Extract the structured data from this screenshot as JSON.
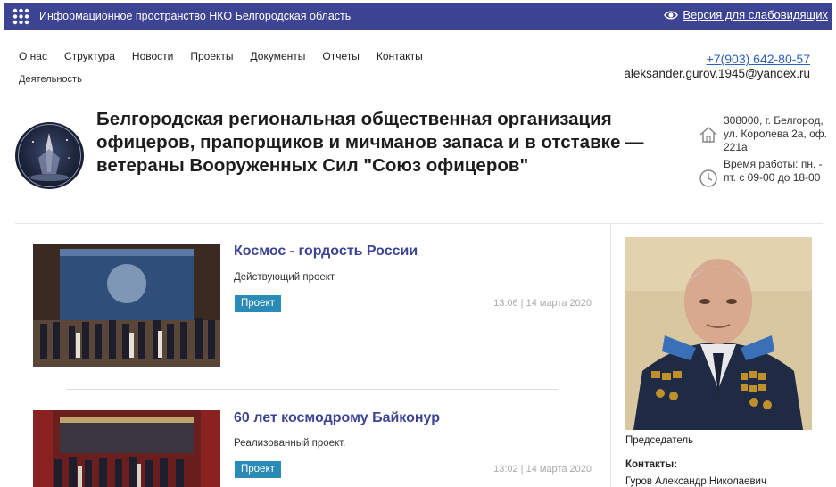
{
  "topbar": {
    "brand": "Информационное пространство НКО Белгородская область",
    "vision_label": "Версия для слабовидящих",
    "bg_color": "#3d4494"
  },
  "nav": {
    "items": [
      "О нас",
      "Структура",
      "Новости",
      "Проекты",
      "Документы",
      "Отчеты",
      "Контакты"
    ],
    "second_row": "Деятельность"
  },
  "contacts_top": {
    "phone": "+7(903) 642-80-57",
    "email": "aleksander.gurov.1945@yandex.ru"
  },
  "org": {
    "title": "Белгородская региональная общественная организация офицеров, прапорщиков и мичманов запаса и в отставке — ветераны Вооруженных Сил \"Союз офицеров\""
  },
  "address": {
    "text": "308000, г. Белгород, ул. Королева 2а, оф. 221а",
    "hours": "Время работы: пн. - пт. с 09-00 до 18-00"
  },
  "news": [
    {
      "title": "Космос - гордость России",
      "desc": "Действующий проект.",
      "tag": "Проект",
      "date": "13:06 | 14 марта 2020"
    },
    {
      "title": "60 лет космодрому Байконур",
      "desc": "Реализованный проект.",
      "tag": "Проект",
      "date": "13:02 | 14 марта 2020"
    }
  ],
  "sidebar": {
    "caption": "Председатель",
    "contacts_heading": "Контакты:",
    "contacts_name": "Гуров Александр Николаевич"
  },
  "colors": {
    "accent": "#3d4494",
    "link": "#2d62b8",
    "tag": "#2a8bb7"
  }
}
